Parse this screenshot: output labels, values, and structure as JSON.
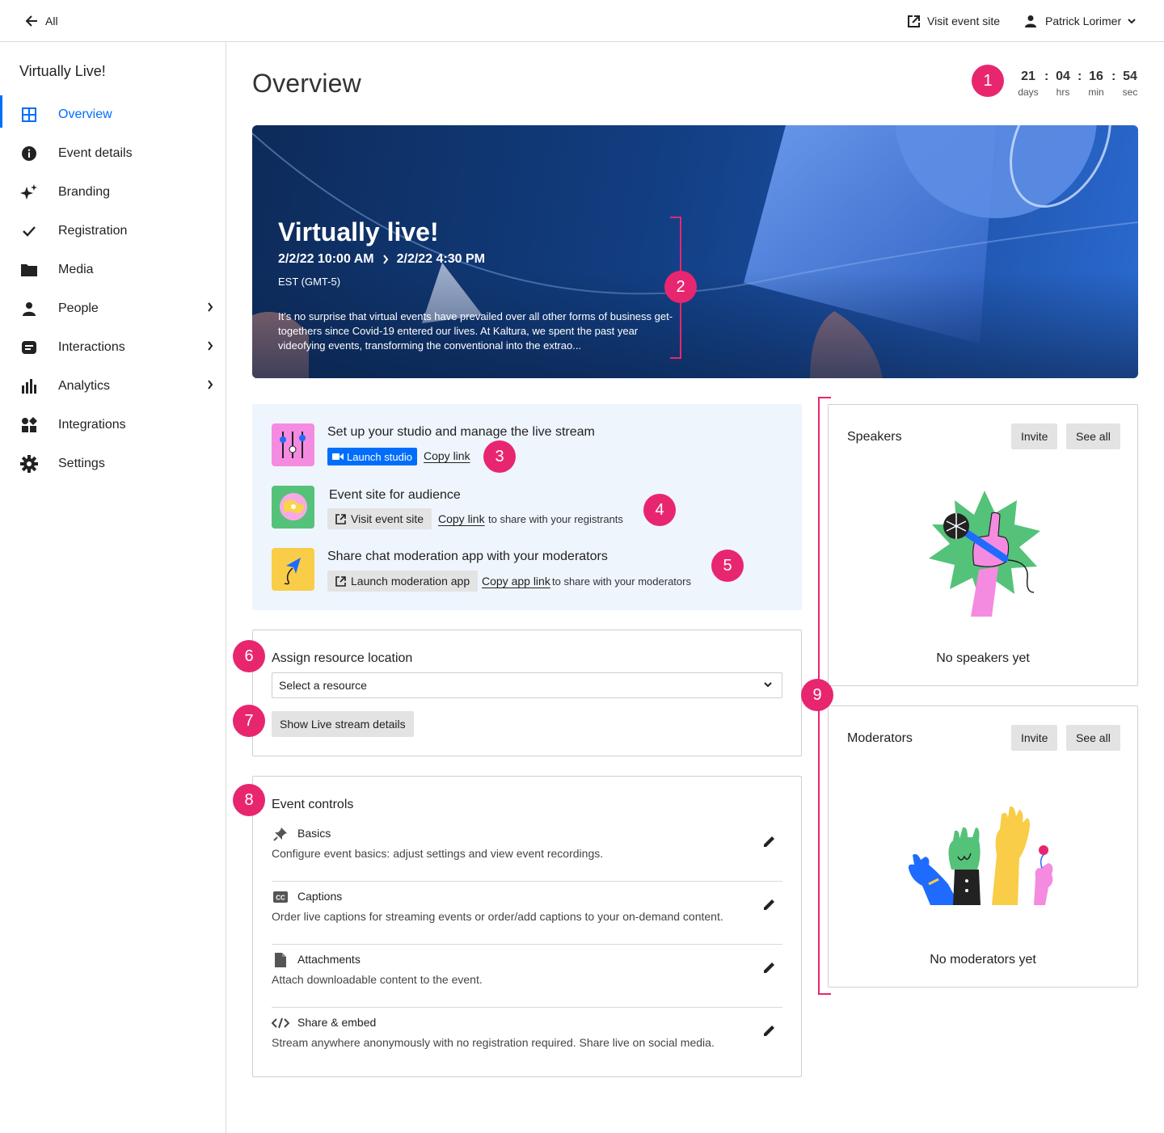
{
  "topbar": {
    "back_label": "All",
    "visit_label": "Visit event site",
    "user_name": "Patrick Lorimer"
  },
  "sidebar": {
    "event_name": "Virtually Live!",
    "items": [
      {
        "label": "Overview",
        "icon": "grid-icon",
        "active": true
      },
      {
        "label": "Event details",
        "icon": "info-icon"
      },
      {
        "label": "Branding",
        "icon": "sparkle-icon"
      },
      {
        "label": "Registration",
        "icon": "check-icon"
      },
      {
        "label": "Media",
        "icon": "folder-icon"
      },
      {
        "label": "People",
        "icon": "person-icon",
        "has_submenu": true
      },
      {
        "label": "Interactions",
        "icon": "chat-icon",
        "has_submenu": true
      },
      {
        "label": "Analytics",
        "icon": "bar-chart-icon",
        "has_submenu": true
      },
      {
        "label": "Integrations",
        "icon": "apps-icon"
      },
      {
        "label": "Settings",
        "icon": "gear-icon"
      }
    ]
  },
  "main": {
    "title": "Overview",
    "countdown": {
      "days": "21",
      "hrs": "04",
      "min": "16",
      "sec": "54",
      "days_label": "days",
      "hrs_label": "hrs",
      "min_label": "min",
      "sec_label": "sec",
      "separator": ":"
    },
    "badges": [
      "1",
      "2",
      "3",
      "4",
      "5",
      "6",
      "7",
      "8",
      "9"
    ],
    "hero": {
      "title": "Virtually live!",
      "start": "2/2/22 10:00 AM",
      "end": "2/2/22 4:30 PM",
      "timezone": "EST (GMT-5)",
      "description": "It's no surprise that virtual events have prevailed over all other forms of business get-togethers since Covid-19 entered our lives. At Kaltura, we spent the past year videofying events, transforming the conventional into the extrao..."
    },
    "setup": {
      "studio": {
        "title": "Set up your studio and manage the live stream",
        "launch_label": "Launch studio",
        "copy_label": "Copy link"
      },
      "site": {
        "title": "Event site for audience",
        "visit_label": "Visit event site",
        "copy_label": "Copy link",
        "helper": "to share with your registrants"
      },
      "moderation": {
        "title": "Share chat moderation app with your moderators",
        "launch_label": "Launch moderation app",
        "copy_label": "Copy app link",
        "helper": "to share with your moderators"
      }
    },
    "resource": {
      "title": "Assign resource location",
      "select_value": "Select a resource",
      "details_button": "Show Live stream details"
    },
    "controls": {
      "title": "Event controls",
      "items": [
        {
          "title": "Basics",
          "description": "Configure event basics: adjust settings and view event recordings.",
          "icon": "pin-icon"
        },
        {
          "title": "Captions",
          "description": "Order live captions for streaming events or order/add captions to your on-demand content.",
          "icon": "cc-icon"
        },
        {
          "title": "Attachments",
          "description": "Attach downloadable content to the event.",
          "icon": "file-icon"
        },
        {
          "title": "Share & embed",
          "description": "Stream anywhere anonymously with no registration required. Share live on social media.",
          "icon": "code-icon"
        }
      ]
    },
    "speakers": {
      "title": "Speakers",
      "invite_label": "Invite",
      "see_all_label": "See all",
      "empty": "No speakers yet"
    },
    "moderators": {
      "title": "Moderators",
      "invite_label": "Invite",
      "see_all_label": "See all",
      "empty": "No moderators yet"
    }
  },
  "colors": {
    "accent": "#006efa",
    "annotation": "#e8266f",
    "panel_bg": "#eef5fd"
  }
}
